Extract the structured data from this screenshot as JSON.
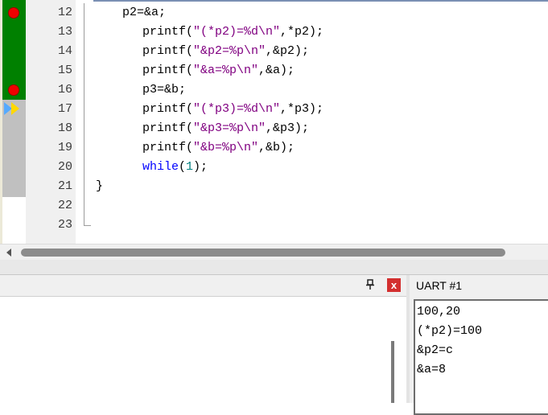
{
  "editor": {
    "line_numbers": [
      "12",
      "13",
      "14",
      "15",
      "16",
      "17",
      "18",
      "19",
      "20",
      "21",
      "22",
      "23"
    ],
    "lines": {
      "l12": "p2=&a;",
      "l13_fn": "printf(",
      "l13_str": "\"(*p2)=%d\\n\"",
      "l13_rest": ",*p2);",
      "l14_fn": "printf(",
      "l14_str": "\"&p2=%p\\n\"",
      "l14_rest": ",&p2);",
      "l15_fn": "printf(",
      "l15_str": "\"&a=%p\\n\"",
      "l15_rest": ",&a);",
      "l16": "p3=&b;",
      "l17_fn": "printf(",
      "l17_str": "\"(*p3)=%d\\n\"",
      "l17_rest": ",*p3);",
      "l18_fn": "printf(",
      "l18_str": "\"&p3=%p\\n\"",
      "l18_rest": ",&p3);",
      "l19_fn": "printf(",
      "l19_str": "\"&b=%p\\n\"",
      "l19_rest": ",&b);",
      "l20_kw": "while",
      "l20_open": "(",
      "l20_num": "1",
      "l20_close": ");",
      "l21": "}"
    },
    "breakpoint_lines": [
      "12",
      "16"
    ],
    "current_line": "17",
    "colors": {
      "string": "#800080",
      "keyword": "#0000ff",
      "number": "#008080",
      "breakpoint": "#ef0000",
      "executed_margin": "#008000"
    }
  },
  "panel": {
    "pin_icon": "pin-icon",
    "close_icon": "close-icon",
    "close_glyph": "x"
  },
  "uart": {
    "title": "UART #1",
    "lines": [
      "100,20",
      "(*p2)=100",
      "&p2=c",
      "&a=8"
    ]
  }
}
